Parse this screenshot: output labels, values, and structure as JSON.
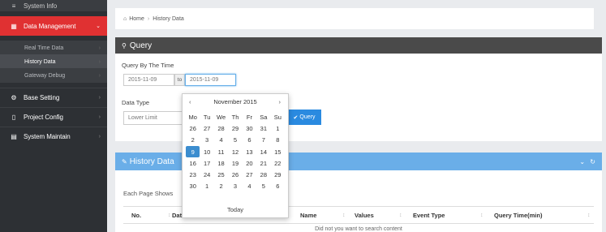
{
  "sidebar": {
    "top_label": "System Info",
    "items": [
      {
        "label": "Data Management",
        "icon": "chart-icon",
        "active": true
      },
      {
        "label": "Base Setting",
        "icon": "settings-icon"
      },
      {
        "label": "Project Config",
        "icon": "file-icon"
      },
      {
        "label": "System Maintain",
        "icon": "list-icon"
      }
    ],
    "sub_items": [
      {
        "label": "Real Time Data"
      },
      {
        "label": "History Data",
        "selected": true
      },
      {
        "label": "Gateway Debug"
      }
    ]
  },
  "breadcrumb": {
    "home": "Home",
    "current": "History Data"
  },
  "query": {
    "title": "Query",
    "by_time_label": "Query By The Time",
    "start_date": "2015-11-09",
    "to_label": "to",
    "end_date": "2015-11-09",
    "data_type_label": "Data Type",
    "data_type_value": "Lower Limit",
    "button": "Query"
  },
  "history": {
    "title": "History Data",
    "each_page": "Each Page Shows",
    "columns": [
      "No.",
      "Dat",
      "Name",
      "Values",
      "Event Type",
      "Query Time(min)"
    ],
    "no_data": "Did not you want to search content"
  },
  "datepicker": {
    "month_title": "November 2015",
    "prev": "‹",
    "next": "›",
    "weekdays": [
      "Mo",
      "Tu",
      "We",
      "Th",
      "Fr",
      "Sa",
      "Su"
    ],
    "days": [
      {
        "d": "26",
        "old": true
      },
      {
        "d": "27",
        "old": true
      },
      {
        "d": "28",
        "old": true
      },
      {
        "d": "29",
        "old": true
      },
      {
        "d": "30",
        "old": true
      },
      {
        "d": "31",
        "old": true
      },
      {
        "d": "1"
      },
      {
        "d": "2"
      },
      {
        "d": "3"
      },
      {
        "d": "4"
      },
      {
        "d": "5"
      },
      {
        "d": "6"
      },
      {
        "d": "7"
      },
      {
        "d": "8"
      },
      {
        "d": "9",
        "active": true
      },
      {
        "d": "10"
      },
      {
        "d": "11"
      },
      {
        "d": "12"
      },
      {
        "d": "13"
      },
      {
        "d": "14"
      },
      {
        "d": "15"
      },
      {
        "d": "16"
      },
      {
        "d": "17"
      },
      {
        "d": "18"
      },
      {
        "d": "19"
      },
      {
        "d": "20"
      },
      {
        "d": "21"
      },
      {
        "d": "22"
      },
      {
        "d": "23"
      },
      {
        "d": "24"
      },
      {
        "d": "25"
      },
      {
        "d": "26"
      },
      {
        "d": "27"
      },
      {
        "d": "28"
      },
      {
        "d": "29"
      },
      {
        "d": "30"
      },
      {
        "d": "1",
        "old": true
      },
      {
        "d": "2",
        "old": true
      },
      {
        "d": "3",
        "old": true
      },
      {
        "d": "4",
        "old": true
      },
      {
        "d": "5",
        "old": true
      },
      {
        "d": "6",
        "old": true
      }
    ],
    "today": "Today"
  },
  "colors": {
    "accent": "#e03132",
    "primary": "#2a8ae0",
    "sidebar": "#2d3034"
  }
}
